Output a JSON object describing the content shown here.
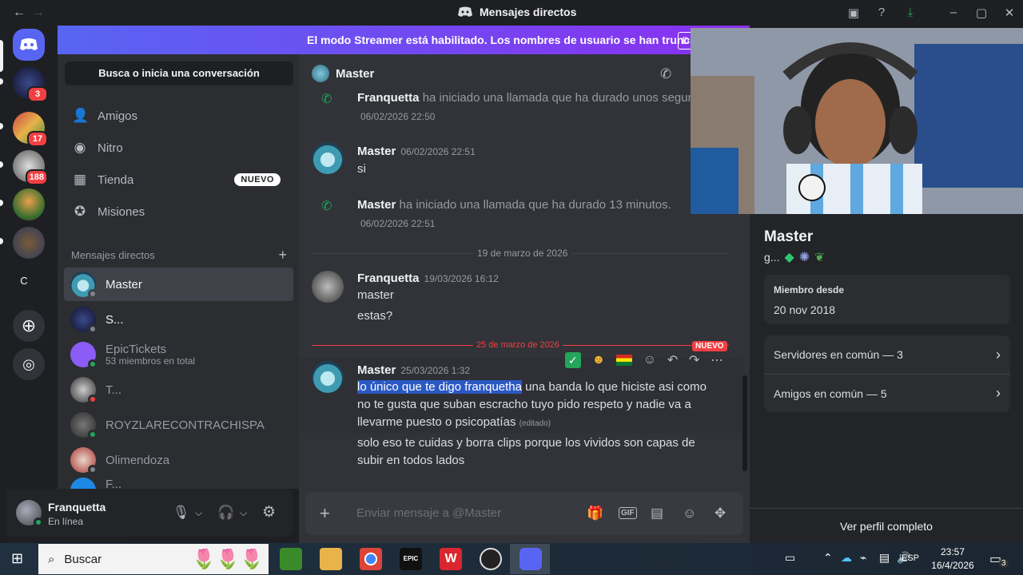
{
  "window": {
    "title": "Mensajes directos"
  },
  "banner": {
    "text": "El modo Streamer está habilitado. Los nombres de usuario se han truncado.",
    "button": "D"
  },
  "search": {
    "label": "Busca o inicia una conversación"
  },
  "nav": [
    {
      "label": "Amigos",
      "icon": "friends-icon"
    },
    {
      "label": "Nitro",
      "icon": "nitro-icon"
    },
    {
      "label": "Tienda",
      "icon": "shop-icon",
      "badge": "NUEVO"
    },
    {
      "label": "Misiones",
      "icon": "quests-icon"
    }
  ],
  "guilds": [
    {
      "badge": "3"
    },
    {
      "badge": "17"
    },
    {
      "badge": "188"
    },
    {
      "badge": ""
    },
    {
      "badge": ""
    },
    {
      "label": "C"
    }
  ],
  "dm_section": {
    "title": "Mensajes directos"
  },
  "dms": [
    {
      "name": "Master",
      "status": "offline"
    },
    {
      "name": "S...",
      "status": "offline"
    },
    {
      "name": "EpicTickets",
      "sub": "53 miembros en total",
      "status": "online"
    },
    {
      "name": "T...",
      "status": "dnd"
    },
    {
      "name": "ROYZLARECONTRACHISPA",
      "status": "online"
    },
    {
      "name": "Olimendoza",
      "status": "offline"
    },
    {
      "name": "F...",
      "status": "offline"
    }
  ],
  "user": {
    "name": "Franquetta",
    "status": "En línea"
  },
  "chat": {
    "recipient": "Master",
    "call1": {
      "name": "Franquetta",
      "text": "ha iniciado una llamada que ha durado unos segun",
      "time": "06/02/2026 22:50"
    },
    "msg1": {
      "name": "Master",
      "time": "06/02/2026 22:51",
      "text": "si"
    },
    "call2": {
      "name": "Master",
      "text": "ha iniciado una llamada que ha durado 13 minutos.",
      "time": "06/02/2026 22:51"
    },
    "divider1": "19 de marzo de 2026",
    "msg2": {
      "name": "Franquetta",
      "time": "19/03/2026 16:12",
      "line1": "master",
      "line2": "estas?"
    },
    "divider2": "25 de marzo de 2026",
    "new_tag": "NUEVO",
    "msg3": {
      "name": "Master",
      "time": "25/03/2026 1:32",
      "highlighted": "lo único que te digo franquetha",
      "rest1": " una banda lo que hiciste asi como",
      "line2": "no te gusta que suban escracho tuyo pido respeto y nadie va a",
      "line3": "llevarme puesto o psicopatías",
      "edited": "(editado)",
      "line4": "solo eso te cuidas y borra clips porque los vividos son capas de",
      "line5": "subir en todos lados"
    },
    "composer_placeholder": "Enviar mensaje a @Master"
  },
  "profile": {
    "name": "Master",
    "tag": "g...",
    "member_since_label": "Miembro desde",
    "member_since": "20 nov 2018",
    "servers": "Servidores en común — 3",
    "friends": "Amigos en común — 5",
    "view_full": "Ver perfil completo"
  },
  "taskbar": {
    "search": "Buscar",
    "lang": "ESP",
    "time": "23:57",
    "date": "16/4/2026",
    "notif": "3"
  },
  "colors": {
    "blurple": "#5865f2",
    "online": "#23a55a",
    "dnd": "#f23f43",
    "bg": "#313338"
  }
}
